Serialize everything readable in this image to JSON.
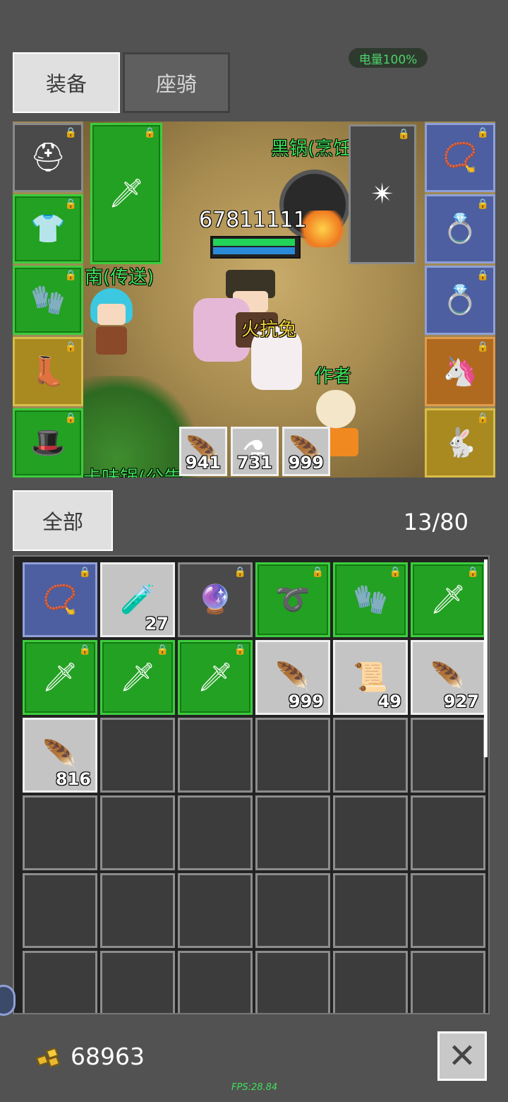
{
  "tabs": [
    {
      "label": "装备",
      "active": true
    },
    {
      "label": "座骑",
      "active": false
    }
  ],
  "battery": "电量100%",
  "scene": {
    "pot_label": "黑锅(烹饪",
    "hp_value": "67811111",
    "npc_label": "南(传送)",
    "pet_label": "火抗兔",
    "author_label": "作者",
    "bottom_label": "卡味锅(公告",
    "hp_fill": 1.0,
    "mp_fill": 1.0
  },
  "equipment_left": [
    {
      "name": "helmet-icon",
      "color": "gray",
      "glyph": "⛑",
      "locked": true
    },
    {
      "name": "armor-icon",
      "color": "green",
      "glyph": "👕",
      "locked": true
    },
    {
      "name": "gloves-icon",
      "color": "green",
      "glyph": "🧤",
      "locked": true
    },
    {
      "name": "boots-icon",
      "color": "gold",
      "glyph": "👢",
      "locked": true
    },
    {
      "name": "cap-icon",
      "color": "green",
      "glyph": "🎩",
      "locked": true
    }
  ],
  "weapon_slot": {
    "name": "sword-icon",
    "color": "green",
    "glyph": "🗡",
    "locked": true
  },
  "offhand_slot": {
    "name": "spiked-ball-icon",
    "color": "gray",
    "glyph": "✴",
    "locked": true
  },
  "equipment_right": [
    {
      "name": "necklace-icon",
      "color": "blue",
      "glyph": "📿",
      "locked": true
    },
    {
      "name": "ring-purple-icon",
      "color": "blue",
      "glyph": "💍",
      "locked": true
    },
    {
      "name": "ring-green-icon",
      "color": "blue",
      "glyph": "💍",
      "locked": true
    },
    {
      "name": "unicorn-mount-icon",
      "color": "orange",
      "glyph": "🦄",
      "locked": true
    },
    {
      "name": "rabbit-pet-icon",
      "color": "gold",
      "glyph": "🐇",
      "locked": true
    }
  ],
  "quickbar": [
    {
      "name": "red-feather-icon",
      "glyph": "🪶",
      "count": "941"
    },
    {
      "name": "teal-potion-icon",
      "glyph": "⚗",
      "count": "731"
    },
    {
      "name": "blue-feather-icon",
      "glyph": "🪶",
      "count": "999"
    }
  ],
  "filter_label": "全部",
  "capacity": "13/80",
  "inventory": [
    {
      "name": "necklace-icon",
      "color": "blue",
      "glyph": "📿",
      "locked": true,
      "count": ""
    },
    {
      "name": "red-potion-icon",
      "color": "lightgray",
      "glyph": "🧪",
      "locked": false,
      "count": "27"
    },
    {
      "name": "dark-orb-icon",
      "color": "gray",
      "glyph": "🔮",
      "locked": true,
      "count": ""
    },
    {
      "name": "bracelet-icon",
      "color": "green",
      "glyph": "➰",
      "locked": true,
      "count": ""
    },
    {
      "name": "gauntlet-icon",
      "color": "green",
      "glyph": "🧤",
      "locked": true,
      "count": ""
    },
    {
      "name": "sword-icon",
      "color": "green",
      "glyph": "🗡",
      "locked": true,
      "count": ""
    },
    {
      "name": "sword-icon",
      "color": "green",
      "glyph": "🗡",
      "locked": true,
      "count": ""
    },
    {
      "name": "sword-icon",
      "color": "green",
      "glyph": "🗡",
      "locked": true,
      "count": ""
    },
    {
      "name": "sword-icon",
      "color": "green",
      "glyph": "🗡",
      "locked": true,
      "count": ""
    },
    {
      "name": "blue-feather-icon",
      "color": "lightgray",
      "glyph": "🪶",
      "locked": false,
      "count": "999"
    },
    {
      "name": "scroll-icon",
      "color": "lightgray",
      "glyph": "📜",
      "locked": false,
      "count": "49"
    },
    {
      "name": "red-feather-icon",
      "color": "lightgray",
      "glyph": "🪶",
      "locked": false,
      "count": "927"
    },
    {
      "name": "blue-feather-icon",
      "color": "lightgray",
      "glyph": "🪶",
      "locked": false,
      "count": "816"
    }
  ],
  "gold": "68963",
  "fps": "FPS:28.84",
  "colors": {
    "accent_green": "#3ee05a",
    "slot_green": "#23a123",
    "slot_blue": "#4d5fa0"
  }
}
